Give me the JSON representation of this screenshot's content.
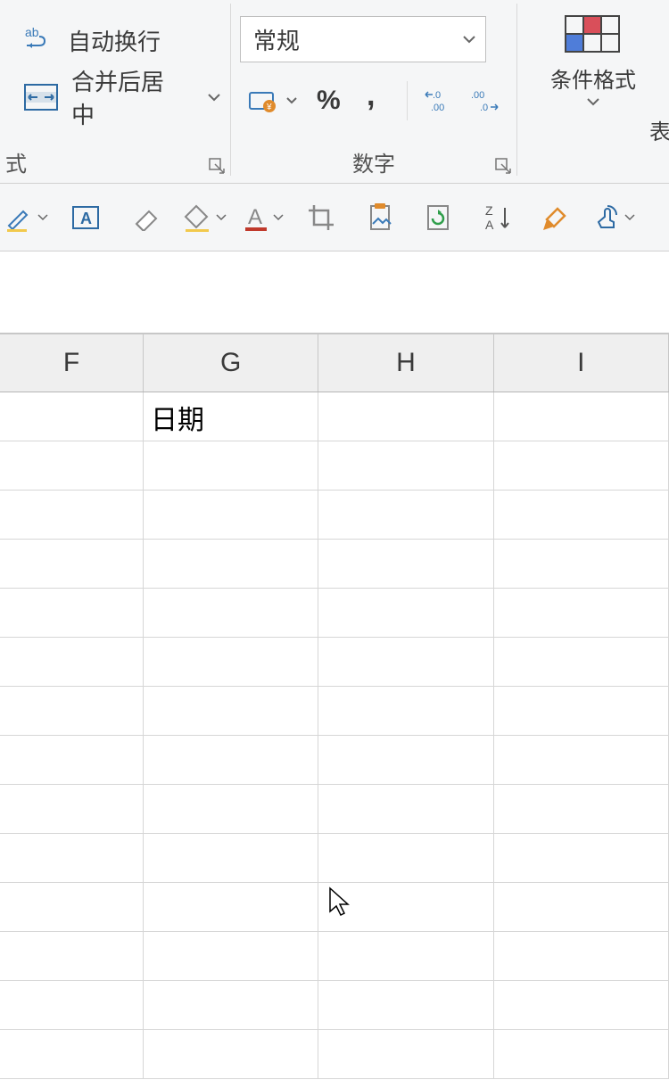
{
  "ribbon": {
    "align": {
      "wrap_label": "自动换行",
      "merge_label": "合并后居中",
      "group_label": "式"
    },
    "number": {
      "format_value": "常规",
      "group_label": "数字"
    },
    "styles": {
      "conditional_label": "条件格式",
      "partial_label": "表"
    }
  },
  "grid": {
    "columns": [
      "F",
      "G",
      "H",
      "I"
    ],
    "cells": {
      "G1": "日期"
    }
  }
}
